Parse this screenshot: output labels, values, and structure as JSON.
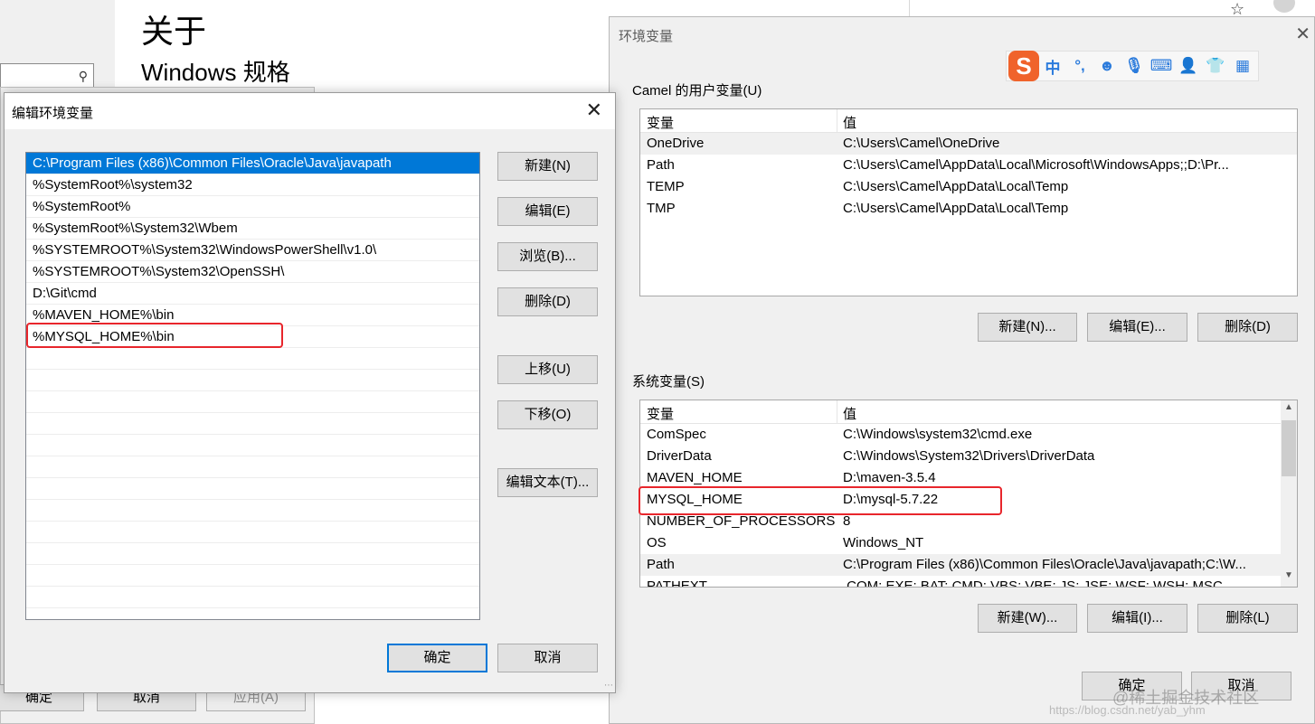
{
  "background": {
    "title": "关于",
    "subtitle": "Windows 规格",
    "search_icon": "search-icon",
    "ok_label": "确定",
    "cancel_label": "取消",
    "apply_label": "应用(A)"
  },
  "env_dialog": {
    "title": "环境变量",
    "ime_logo": "S",
    "ime_items": [
      "中",
      "°,",
      "☻",
      "🎙",
      "⌨",
      "👤",
      "👕",
      "▦"
    ],
    "user_group_label": "Camel 的用户变量(U)",
    "col_var": "变量",
    "col_val": "值",
    "user_vars": [
      {
        "name": "OneDrive",
        "value": "C:\\Users\\Camel\\OneDrive"
      },
      {
        "name": "Path",
        "value": "C:\\Users\\Camel\\AppData\\Local\\Microsoft\\WindowsApps;;D:\\Pr..."
      },
      {
        "name": "TEMP",
        "value": "C:\\Users\\Camel\\AppData\\Local\\Temp"
      },
      {
        "name": "TMP",
        "value": "C:\\Users\\Camel\\AppData\\Local\\Temp"
      }
    ],
    "user_buttons": {
      "new": "新建(N)...",
      "edit": "编辑(E)...",
      "delete": "删除(D)"
    },
    "system_group_label": "系统变量(S)",
    "system_vars": [
      {
        "name": "ComSpec",
        "value": "C:\\Windows\\system32\\cmd.exe"
      },
      {
        "name": "DriverData",
        "value": "C:\\Windows\\System32\\Drivers\\DriverData"
      },
      {
        "name": "MAVEN_HOME",
        "value": "D:\\maven-3.5.4"
      },
      {
        "name": "MYSQL_HOME",
        "value": "D:\\mysql-5.7.22"
      },
      {
        "name": "NUMBER_OF_PROCESSORS",
        "value": "8"
      },
      {
        "name": "OS",
        "value": "Windows_NT"
      },
      {
        "name": "Path",
        "value": "C:\\Program Files (x86)\\Common Files\\Oracle\\Java\\javapath;C:\\W..."
      },
      {
        "name": "PATHEXT",
        "value": ".COM;.EXE;.BAT;.CMD;.VBS;.VBE;.JS;.JSE;.WSF;.WSH;.MSC"
      }
    ],
    "system_buttons": {
      "new": "新建(W)...",
      "edit": "编辑(I)...",
      "delete": "删除(L)"
    },
    "ok_label": "确定",
    "cancel_label": "取消"
  },
  "edit_dialog": {
    "title": "编辑环境变量",
    "paths": [
      "C:\\Program Files (x86)\\Common Files\\Oracle\\Java\\javapath",
      "%SystemRoot%\\system32",
      "%SystemRoot%",
      "%SystemRoot%\\System32\\Wbem",
      "%SYSTEMROOT%\\System32\\WindowsPowerShell\\v1.0\\",
      "%SYSTEMROOT%\\System32\\OpenSSH\\",
      "D:\\Git\\cmd",
      "%MAVEN_HOME%\\bin",
      "%MYSQL_HOME%\\bin"
    ],
    "buttons": {
      "new": "新建(N)",
      "edit": "编辑(E)",
      "browse": "浏览(B)...",
      "delete": "删除(D)",
      "move_up": "上移(U)",
      "move_down": "下移(O)",
      "edit_text": "编辑文本(T)..."
    },
    "ok_label": "确定",
    "cancel_label": "取消"
  },
  "watermark": {
    "text": "@稀土掘金技术社区",
    "url": "https://blog.csdn.net/yab_yhm"
  },
  "colors": {
    "selection": "#0078d7",
    "highlight_box": "#e8262c",
    "ime_brand": "#f0632b",
    "ime_icon": "#2b7bdc"
  }
}
